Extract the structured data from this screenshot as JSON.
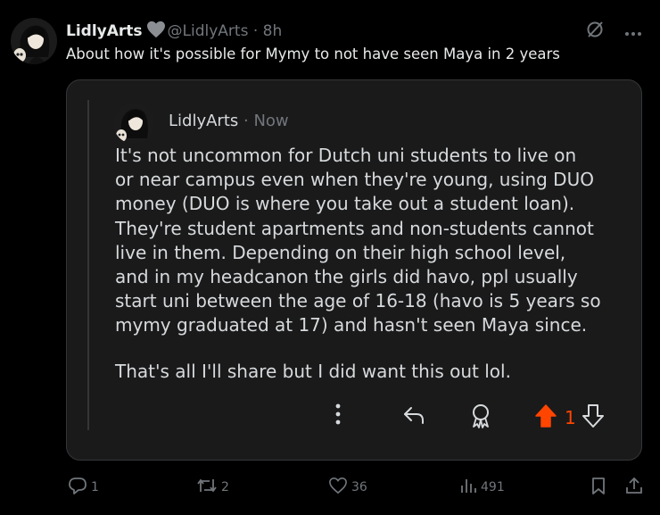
{
  "tweet": {
    "display_name": "LidlyArts",
    "handle": "@LidlyArts",
    "time": "8h",
    "text": "About how it's possible for Mymy to not have seen Maya in 2 years"
  },
  "embed": {
    "username": "LidlyArts",
    "time": "Now",
    "paragraphs": [
      "It's not uncommon for Dutch uni students to live on\nor near campus even when they're young, using DUO\nmoney (DUO is where you take out a student loan).\nThey're student apartments and non-students cannot\nlive in them. Depending on their high school level,\nand in my headcanon the girls did havo, ppl usually\nstart uni between the age of 16-18 (havo is 5 years so\nmymy graduated at 17) and hasn't seen Maya since.",
      "That's all I'll share but I did want this out lol."
    ],
    "upvotes": "1",
    "upvote_color": "#ff4500"
  },
  "actions": {
    "replies": "1",
    "reposts": "2",
    "likes": "36",
    "views": "491"
  },
  "icons": [
    "heart-icon",
    "grok-icon",
    "more-icon",
    "kebab-icon",
    "reply-arrow-icon",
    "award-icon",
    "upvote-icon",
    "downvote-icon",
    "reply-icon",
    "repost-icon",
    "like-icon",
    "views-icon",
    "bookmark-icon",
    "share-icon"
  ]
}
